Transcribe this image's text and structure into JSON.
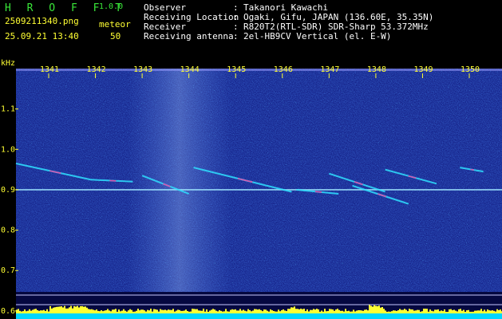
{
  "header": {
    "app_title": "H R O F F T",
    "app_version": "1.0.0",
    "file_name": "2509211340.png",
    "meteor_label": "meteor",
    "timestamp": "25.09.21 13:40",
    "meteor_count": "50"
  },
  "info": [
    {
      "label": "Observer",
      "sep": ":",
      "value": "Takanori Kawachi"
    },
    {
      "label": "Receiving Location",
      "sep": ":",
      "value": "Ogaki, Gifu, JAPAN (136.60E, 35.35N)"
    },
    {
      "label": "Receiver",
      "sep": ":",
      "value": "R820T2(RTL-SDR) SDR-Sharp 53.372MHz"
    },
    {
      "label": "Receiving antenna",
      "sep": ":",
      "value": "2el-HB9CV Vertical (el. E-W)"
    }
  ],
  "chart_data": {
    "type": "heatmap",
    "ylabel": "kHz",
    "x_ticks": [
      "1341",
      "1342",
      "1343",
      "1344",
      "1345",
      "1346",
      "1347",
      "1348",
      "1349",
      "1350"
    ],
    "y_ticks": [
      "1.1",
      "1.0",
      "0.9",
      "0.8",
      "0.7",
      "0.6"
    ],
    "x_range": [
      1340.3,
      1350.7
    ],
    "y_range": [
      0.58,
      1.2
    ],
    "carrier_khz": 0.9,
    "echoes": [
      {
        "x0": 1340.3,
        "y0": 0.965,
        "x1": 1341.9,
        "y1": 0.925
      },
      {
        "x0": 1341.9,
        "y0": 0.925,
        "x1": 1342.8,
        "y1": 0.92
      },
      {
        "x0": 1343.0,
        "y0": 0.935,
        "x1": 1344.0,
        "y1": 0.89
      },
      {
        "x0": 1344.1,
        "y0": 0.955,
        "x1": 1346.2,
        "y1": 0.895
      },
      {
        "x0": 1346.3,
        "y0": 0.9,
        "x1": 1347.2,
        "y1": 0.89
      },
      {
        "x0": 1347.0,
        "y0": 0.94,
        "x1": 1348.2,
        "y1": 0.895
      },
      {
        "x0": 1347.5,
        "y0": 0.91,
        "x1": 1348.7,
        "y1": 0.865
      },
      {
        "x0": 1348.2,
        "y0": 0.95,
        "x1": 1349.3,
        "y1": 0.915
      },
      {
        "x0": 1349.8,
        "y0": 0.955,
        "x1": 1350.3,
        "y1": 0.945
      }
    ],
    "colors": {
      "noise": "#1a2a9c",
      "accent": "#ffff33",
      "strong": "#ff3aa0"
    }
  }
}
